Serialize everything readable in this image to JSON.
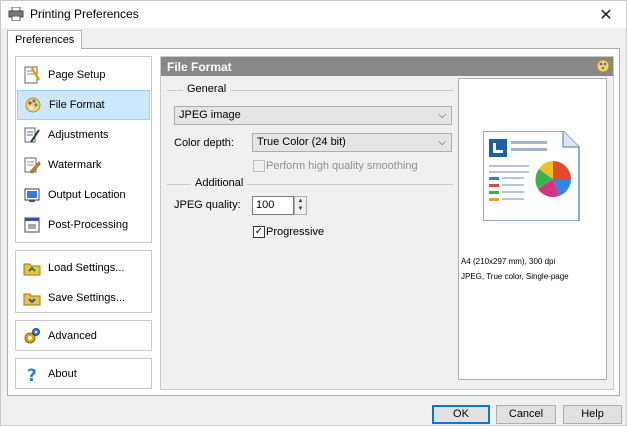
{
  "window": {
    "title": "Printing Preferences"
  },
  "tabs": [
    {
      "label": "Preferences"
    }
  ],
  "nav": {
    "group1": [
      {
        "label": "Page Setup",
        "icon": "page-setup-icon"
      },
      {
        "label": "File Format",
        "icon": "file-format-icon",
        "selected": true
      },
      {
        "label": "Adjustments",
        "icon": "adjustments-icon"
      },
      {
        "label": "Watermark",
        "icon": "watermark-icon"
      },
      {
        "label": "Output Location",
        "icon": "output-location-icon"
      },
      {
        "label": "Post-Processing",
        "icon": "post-processing-icon"
      }
    ],
    "group2": [
      {
        "label": "Load Settings...",
        "icon": "load-settings-icon"
      },
      {
        "label": "Save Settings...",
        "icon": "save-settings-icon"
      }
    ],
    "group3": [
      {
        "label": "Advanced",
        "icon": "advanced-gear-icon"
      }
    ],
    "group4": [
      {
        "label": "About",
        "icon": "question-icon"
      }
    ]
  },
  "panel": {
    "title": "File Format",
    "general_label": "General",
    "format_value": "JPEG image",
    "color_depth_label": "Color depth:",
    "color_depth_value": "True Color (24 bit)",
    "smoothing_label": "Perform high quality smoothing",
    "smoothing_checked": false,
    "additional_label": "Additional",
    "jpeg_quality_label": "JPEG quality:",
    "jpeg_quality_value": "100",
    "progressive_label": "Progressive",
    "progressive_checked": true
  },
  "preview": {
    "line1": "A4 (210x297 mm), 300 dpi",
    "line2": "JPEG, True color, Single-page"
  },
  "buttons": {
    "ok": "OK",
    "cancel": "Cancel",
    "help": "Help"
  },
  "colors": {
    "selected_bg": "#cce8ff",
    "header_bg": "#888888",
    "accent": "#0078d7"
  }
}
